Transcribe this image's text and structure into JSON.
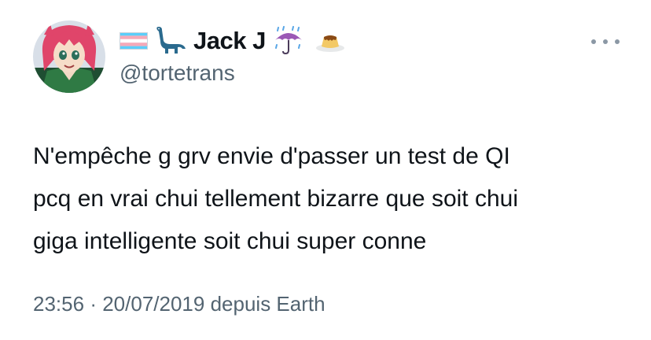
{
  "tweet": {
    "display_name": "Jack J",
    "handle": "@tortetrans",
    "text": "N'empêche g grv envie d'passer un test de QI\npcq en vrai chui tellement bizarre que soit chui\ngiga intelligente soit chui super conne",
    "time": "23:56",
    "separator": "·",
    "date": "20/07/2019",
    "source": "depuis Earth",
    "name_icons": [
      "transgender-flag-icon",
      "sauropod-icon",
      "umbrella-with-rain-icon",
      "flan-custard-icon"
    ],
    "more_icon": "more-horizontal-icon"
  },
  "colors": {
    "text_primary": "#0f1419",
    "text_secondary": "#536471",
    "trans_blue": "#5bcefa",
    "trans_pink": "#f5a9b8",
    "dino_blue": "#2a6a8e",
    "umbrella_purple": "#9b59b6"
  }
}
